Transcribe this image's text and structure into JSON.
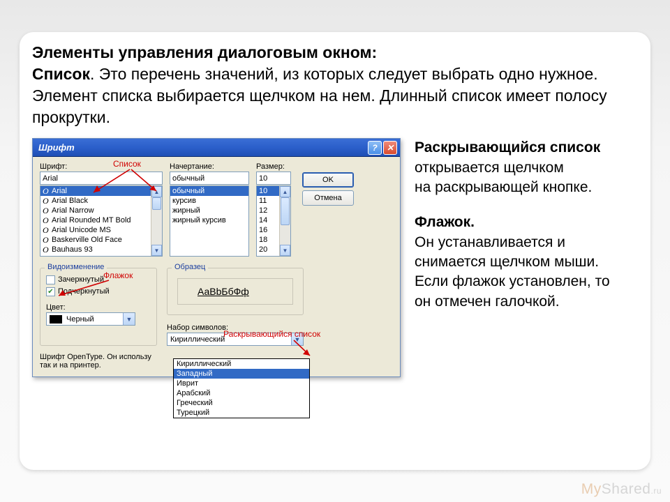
{
  "heading": {
    "bold1": "Элементы управления диалоговым окном:",
    "bold2": "Список",
    "rest": ". Это перечень значений, из которых следует выбрать одно нужное. Элемент списка выбирается щелчком на нем. Длинный список имеет полосу прокрутки."
  },
  "right": {
    "p1_bold": "Раскрывающийся список",
    "p1_rest": " открывается щелчком",
    "p1_line2": " на раскрывающей кнопке.",
    "p2_bold": "Флажок.",
    "p2_rest": "Он устанавливается и снимается щелчком мыши. Если флажок установлен, то он отмечен галочкой."
  },
  "dialog": {
    "title": "Шрифт",
    "font_label": "Шрифт:",
    "font_value": "Arial",
    "style_label": "Начертание:",
    "style_value": "обычный",
    "size_label": "Размер:",
    "size_value": "10",
    "ok": "OK",
    "cancel": "Отмена",
    "fonts": [
      "Arial",
      "Arial Black",
      "Arial Narrow",
      "Arial Rounded MT Bold",
      "Arial Unicode MS",
      "Baskerville Old Face",
      "Bauhaus 93"
    ],
    "styles": [
      "обычный",
      "курсив",
      "жирный",
      "жирный курсив"
    ],
    "sizes": [
      "10",
      "11",
      "12",
      "14",
      "16",
      "18",
      "20"
    ],
    "effects_legend": "Видоизменение",
    "strike_label": "Зачеркнутый",
    "underline_label": "Подчеркнутый",
    "color_label": "Цвет:",
    "color_value": "Черный",
    "sample_legend": "Образец",
    "sample_text": "АаВbБбФф",
    "charset_label": "Набор символов:",
    "charset_value": "Кириллический",
    "charset_opts": [
      "Кириллический",
      "Западный",
      "Иврит",
      "Арабский",
      "Греческий",
      "Турецкий"
    ],
    "info1": "Шрифт OpenType. Он использу",
    "info2": "так и на принтер."
  },
  "annotations": {
    "list": "Список",
    "checkbox": "Флажок",
    "dropdown": "Раскрывающийся список"
  },
  "watermark": {
    "my": "My",
    "shared": "Shared"
  }
}
